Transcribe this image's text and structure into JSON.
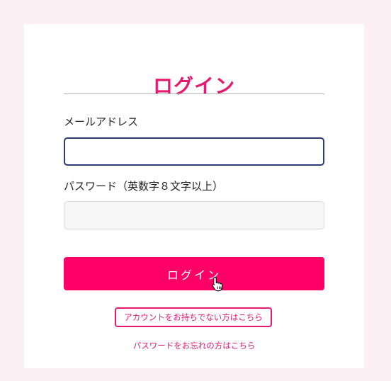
{
  "page": {
    "title": "ログイン"
  },
  "form": {
    "email_label": "メールアドレス",
    "email_value": "",
    "password_label": "パスワード（英数字８文字以上）",
    "password_value": "",
    "submit_label": "ログイン"
  },
  "links": {
    "no_account": "アカウントをお持ちでない方はこちら",
    "forgot_password": "パスワードをお忘れの方はこちら"
  },
  "colors": {
    "accent": "#ff0066",
    "title": "#e6196e",
    "background": "#fdf0f5",
    "focused_border": "#2d3a75"
  },
  "icons": {
    "cursor": "hand-pointer-cursor-icon"
  }
}
